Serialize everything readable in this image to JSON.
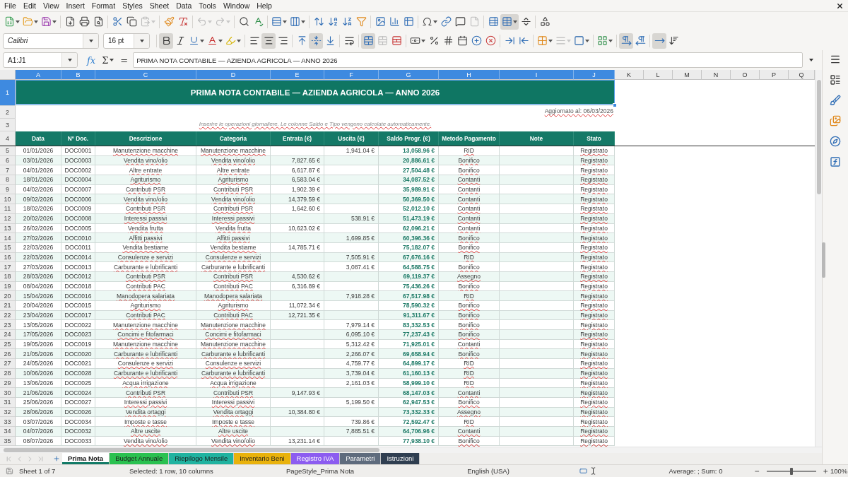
{
  "menu_bar": {
    "items": [
      "File",
      "Edit",
      "View",
      "Insert",
      "Format",
      "Styles",
      "Sheet",
      "Data",
      "Tools",
      "Window",
      "Help"
    ]
  },
  "standard_toolbar": {
    "buttons": [
      {
        "kind": "new",
        "pressed": false,
        "disabled": false
      },
      {
        "kind": "open",
        "pressed": false,
        "disabled": false
      },
      {
        "kind": "save",
        "pressed": false,
        "disabled": false
      },
      {
        "kind": "pdf",
        "pressed": false,
        "disabled": false
      },
      {
        "kind": "print",
        "pressed": false,
        "disabled": false
      },
      {
        "kind": "preview",
        "pressed": false,
        "disabled": false
      },
      {
        "kind": "cut",
        "pressed": false,
        "disabled": false
      },
      {
        "kind": "copy",
        "pressed": false,
        "disabled": false
      },
      {
        "kind": "paste",
        "pressed": false,
        "disabled": true
      },
      {
        "kind": "clone",
        "pressed": false,
        "disabled": false
      },
      {
        "kind": "clear",
        "pressed": false,
        "disabled": false
      },
      {
        "kind": "undo",
        "pressed": false,
        "disabled": true
      },
      {
        "kind": "redo",
        "pressed": false,
        "disabled": true
      },
      {
        "kind": "find",
        "pressed": false,
        "disabled": false
      },
      {
        "kind": "spelling",
        "pressed": false,
        "disabled": false
      },
      {
        "kind": "rows",
        "pressed": false,
        "disabled": false
      },
      {
        "kind": "columns",
        "pressed": false,
        "disabled": false
      },
      {
        "kind": "sort",
        "pressed": false,
        "disabled": false
      },
      {
        "kind": "ascending",
        "pressed": false,
        "disabled": false
      },
      {
        "kind": "descending",
        "pressed": false,
        "disabled": false
      },
      {
        "kind": "autofilter",
        "pressed": false,
        "disabled": false
      },
      {
        "kind": "image",
        "pressed": false,
        "disabled": false
      },
      {
        "kind": "chart",
        "pressed": false,
        "disabled": false
      },
      {
        "kind": "pivot",
        "pressed": false,
        "disabled": false
      },
      {
        "kind": "symbol",
        "pressed": false,
        "disabled": false
      },
      {
        "kind": "hyperlink",
        "pressed": false,
        "disabled": false
      },
      {
        "kind": "comment",
        "pressed": false,
        "disabled": false
      },
      {
        "kind": "headers",
        "pressed": false,
        "disabled": true
      },
      {
        "kind": "printarea",
        "pressed": false,
        "disabled": false
      },
      {
        "kind": "freeze",
        "pressed": true,
        "disabled": false
      },
      {
        "kind": "split",
        "pressed": false,
        "disabled": false
      },
      {
        "kind": "shapes",
        "pressed": false,
        "disabled": false
      }
    ]
  },
  "formatting_toolbar": {
    "font_name": "Calibri",
    "font_size": "16 pt",
    "buttons": [
      {
        "kind": "bold",
        "pressed": true,
        "disabled": false
      },
      {
        "kind": "italic",
        "pressed": false,
        "disabled": false
      },
      {
        "kind": "underline",
        "pressed": false,
        "disabled": false
      },
      {
        "kind": "fontcolor",
        "pressed": false,
        "disabled": false
      },
      {
        "kind": "highlight",
        "pressed": false,
        "disabled": false
      },
      {
        "kind": "left",
        "pressed": false,
        "disabled": false
      },
      {
        "kind": "center",
        "pressed": true,
        "disabled": false
      },
      {
        "kind": "right",
        "pressed": false,
        "disabled": false
      },
      {
        "kind": "top",
        "pressed": false,
        "disabled": false
      },
      {
        "kind": "middle",
        "pressed": true,
        "disabled": false
      },
      {
        "kind": "bottom",
        "pressed": false,
        "disabled": false
      },
      {
        "kind": "wrap",
        "pressed": false,
        "disabled": false
      },
      {
        "kind": "mergecenter",
        "pressed": true,
        "disabled": false
      },
      {
        "kind": "merge",
        "pressed": false,
        "disabled": true
      },
      {
        "kind": "unmerge",
        "pressed": false,
        "disabled": false
      },
      {
        "kind": "currency",
        "pressed": false,
        "disabled": false
      },
      {
        "kind": "percent",
        "pressed": false,
        "disabled": false
      },
      {
        "kind": "number",
        "pressed": false,
        "disabled": false
      },
      {
        "kind": "date",
        "pressed": false,
        "disabled": false
      },
      {
        "kind": "adddecimal",
        "pressed": false,
        "disabled": false
      },
      {
        "kind": "deletedecimal",
        "pressed": false,
        "disabled": false
      },
      {
        "kind": "indent",
        "pressed": false,
        "disabled": false
      },
      {
        "kind": "outdent",
        "pressed": false,
        "disabled": false
      },
      {
        "kind": "borders",
        "pressed": false,
        "disabled": false
      },
      {
        "kind": "borderstyle",
        "pressed": false,
        "disabled": true
      },
      {
        "kind": "bordercolor",
        "pressed": false,
        "disabled": false
      },
      {
        "kind": "conditional",
        "pressed": false,
        "disabled": false
      },
      {
        "kind": "ltr",
        "pressed": true,
        "disabled": false
      },
      {
        "kind": "rtl",
        "pressed": false,
        "disabled": false
      },
      {
        "kind": "direction",
        "pressed": true,
        "disabled": false
      },
      {
        "kind": "stacked",
        "pressed": false,
        "disabled": false
      }
    ]
  },
  "formula_bar": {
    "name_box": "A1:J1",
    "function_symbol": "fx",
    "sum_symbol": "Σ",
    "equals_symbol": "=",
    "content": "PRIMA NOTA CONTABILE — AZIENDA AGRICOLA — ANNO 2026"
  },
  "sheet": {
    "column_headers": [
      {
        "label": "A",
        "selected": true
      },
      {
        "label": "B",
        "selected": true
      },
      {
        "label": "C",
        "selected": true
      },
      {
        "label": "D",
        "selected": true
      },
      {
        "label": "E",
        "selected": true
      },
      {
        "label": "F",
        "selected": true
      },
      {
        "label": "G",
        "selected": true
      },
      {
        "label": "H",
        "selected": true
      },
      {
        "label": "I",
        "selected": true
      },
      {
        "label": "J",
        "selected": true
      },
      {
        "label": "K",
        "selected": false
      },
      {
        "label": "L",
        "selected": false
      },
      {
        "label": "M",
        "selected": false
      },
      {
        "label": "N",
        "selected": false
      },
      {
        "label": "O",
        "selected": false
      },
      {
        "label": "P",
        "selected": false
      },
      {
        "label": "Q",
        "selected": false
      }
    ],
    "row_headers": [
      {
        "label": "1",
        "selected": true
      },
      {
        "label": "2",
        "selected": false
      },
      {
        "label": "3",
        "selected": false
      },
      {
        "label": "4",
        "selected": false
      },
      {
        "label": "5",
        "selected": false
      },
      {
        "label": "6",
        "selected": false
      },
      {
        "label": "7",
        "selected": false
      },
      {
        "label": "8",
        "selected": false
      },
      {
        "label": "9",
        "selected": false
      },
      {
        "label": "10",
        "selected": false
      },
      {
        "label": "11",
        "selected": false
      },
      {
        "label": "12",
        "selected": false
      },
      {
        "label": "13",
        "selected": false
      },
      {
        "label": "14",
        "selected": false
      },
      {
        "label": "15",
        "selected": false
      },
      {
        "label": "16",
        "selected": false
      },
      {
        "label": "17",
        "selected": false
      },
      {
        "label": "18",
        "selected": false
      },
      {
        "label": "19",
        "selected": false
      },
      {
        "label": "20",
        "selected": false
      },
      {
        "label": "21",
        "selected": false
      },
      {
        "label": "22",
        "selected": false
      },
      {
        "label": "23",
        "selected": false
      },
      {
        "label": "24",
        "selected": false
      },
      {
        "label": "25",
        "selected": false
      },
      {
        "label": "26",
        "selected": false
      },
      {
        "label": "27",
        "selected": false
      },
      {
        "label": "28",
        "selected": false
      },
      {
        "label": "29",
        "selected": false
      },
      {
        "label": "30",
        "selected": false
      },
      {
        "label": "31",
        "selected": false
      },
      {
        "label": "32",
        "selected": false
      },
      {
        "label": "33",
        "selected": false
      },
      {
        "label": "34",
        "selected": false
      },
      {
        "label": "35",
        "selected": false
      }
    ],
    "title": "PRIMA NOTA CONTABILE — AZIENDA AGRICOLA — ANNO 2026",
    "updated": {
      "text": "Aggiornato al: 06/03/2026",
      "spelling_flagged": true
    },
    "instructions": {
      "text": "Inserire le operazioni giornaliere. Le colonne Saldo e Tipo vengono calcolate automaticamente.",
      "spelling_flagged": true
    },
    "table": {
      "columns": [
        {
          "label": "Data",
          "spelling_flagged": false
        },
        {
          "label": "Nº Doc.",
          "spelling_flagged": false
        },
        {
          "label": "Descrizione",
          "spelling_flagged": true
        },
        {
          "label": "Categoria",
          "spelling_flagged": true
        },
        {
          "label": "Entrata (€)",
          "spelling_flagged": false
        },
        {
          "label": "Uscita (€)",
          "spelling_flagged": false
        },
        {
          "label": "Saldo Progr. (€)",
          "spelling_flagged": false
        },
        {
          "label": "Metodo Pagamento",
          "spelling_flagged": true
        },
        {
          "label": "Note"
        },
        {
          "label": "Stato",
          "spelling_flagged": true
        }
      ],
      "rows": [
        [
          "01/01/2026",
          "DOC0001",
          "Manutenzione macchine",
          "Manutenzione macchine",
          null,
          "1,941.04 €",
          "13,058.96 €",
          "RID",
          null,
          "Registrato"
        ],
        [
          "03/01/2026",
          "DOC0003",
          "Vendita vino/olio",
          "Vendita vino/olio",
          "7,827.65 €",
          null,
          "20,886.61 €",
          "Bonifico",
          null,
          "Registrato"
        ],
        [
          "04/01/2026",
          "DOC0002",
          "Altre entrate",
          "Altre entrate",
          "6,617.87 €",
          null,
          "27,504.48 €",
          "Bonifico",
          null,
          "Registrato"
        ],
        [
          "18/01/2026",
          "DOC0004",
          "Agriturismo",
          "Agriturismo",
          "6,583.04 €",
          null,
          "34,087.52 €",
          "Contanti",
          null,
          "Registrato"
        ],
        [
          "04/02/2026",
          "DOC0007",
          "Contributi PSR",
          "Contributi PSR",
          "1,902.39 €",
          null,
          "35,989.91 €",
          "Contanti",
          null,
          "Registrato"
        ],
        [
          "09/02/2026",
          "DOC0006",
          "Vendita vino/olio",
          "Vendita vino/olio",
          "14,379.59 €",
          null,
          "50,369.50 €",
          "Contanti",
          null,
          "Registrato"
        ],
        [
          "18/02/2026",
          "DOC0009",
          "Contributi PSR",
          "Contributi PSR",
          "1,642.60 €",
          null,
          "52,012.10 €",
          "Contanti",
          null,
          "Registrato"
        ],
        [
          "20/02/2026",
          "DOC0008",
          "Interessi passivi",
          "Interessi passivi",
          null,
          "538.91 €",
          "51,473.19 €",
          "Contanti",
          null,
          "Registrato"
        ],
        [
          "26/02/2026",
          "DOC0005",
          "Vendita frutta",
          "Vendita frutta",
          "10,623.02 €",
          null,
          "62,096.21 €",
          "Contanti",
          null,
          "Registrato"
        ],
        [
          "27/02/2026",
          "DOC0010",
          "Affitti passivi",
          "Affitti passivi",
          null,
          "1,699.85 €",
          "60,396.36 €",
          "Bonifico",
          null,
          "Registrato"
        ],
        [
          "22/03/2026",
          "DOC0011",
          "Vendita bestiame",
          "Vendita bestiame",
          "14,785.71 €",
          null,
          "75,182.07 €",
          "Bonifico",
          null,
          "Registrato"
        ],
        [
          "22/03/2026",
          "DOC0014",
          "Consulenze e servizi",
          "Consulenze e servizi",
          null,
          "7,505.91 €",
          "67,676.16 €",
          "RID",
          null,
          "Registrato"
        ],
        [
          "27/03/2026",
          "DOC0013",
          "Carburante e lubrificanti",
          "Carburante e lubrificanti",
          null,
          "3,087.41 €",
          "64,588.75 €",
          "Bonifico",
          null,
          "Registrato"
        ],
        [
          "28/03/2026",
          "DOC0012",
          "Contributi PSR",
          "Contributi PSR",
          "4,530.62 €",
          null,
          "69,119.37 €",
          "Assegno",
          null,
          "Registrato"
        ],
        [
          "08/04/2026",
          "DOC0018",
          "Contributi PAC",
          "Contributi PAC",
          "6,316.89 €",
          null,
          "75,436.26 €",
          "Bonifico",
          null,
          "Registrato"
        ],
        [
          "15/04/2026",
          "DOC0016",
          "Manodopera salariata",
          "Manodopera salariata",
          null,
          "7,918.28 €",
          "67,517.98 €",
          "RID",
          null,
          "Registrato"
        ],
        [
          "20/04/2026",
          "DOC0015",
          "Agriturismo",
          "Agriturismo",
          "11,072.34 €",
          null,
          "78,590.32 €",
          "Bonifico",
          null,
          "Registrato"
        ],
        [
          "23/04/2026",
          "DOC0017",
          "Contributi PAC",
          "Contributi PAC",
          "12,721.35 €",
          null,
          "91,311.67 €",
          "Bonifico",
          null,
          "Registrato"
        ],
        [
          "13/05/2026",
          "DOC0022",
          "Manutenzione macchine",
          "Manutenzione macchine",
          null,
          "7,979.14 €",
          "83,332.53 €",
          "Bonifico",
          null,
          "Registrato"
        ],
        [
          "17/05/2026",
          "DOC0023",
          "Concimi e fitofarmaci",
          "Concimi e fitofarmaci",
          null,
          "6,095.10 €",
          "77,237.43 €",
          "Bonifico",
          null,
          "Registrato"
        ],
        [
          "19/05/2026",
          "DOC0019",
          "Manutenzione macchine",
          "Manutenzione macchine",
          null,
          "5,312.42 €",
          "71,925.01 €",
          "Contanti",
          null,
          "Registrato"
        ],
        [
          "21/05/2026",
          "DOC0020",
          "Carburante e lubrificanti",
          "Carburante e lubrificanti",
          null,
          "2,266.07 €",
          "69,658.94 €",
          "Bonifico",
          null,
          "Registrato"
        ],
        [
          "24/05/2026",
          "DOC0021",
          "Consulenze e servizi",
          "Consulenze e servizi",
          null,
          "4,759.77 €",
          "64,899.17 €",
          "RID",
          null,
          "Registrato"
        ],
        [
          "10/06/2026",
          "DOC0028",
          "Carburante e lubrificanti",
          "Carburante e lubrificanti",
          null,
          "3,739.04 €",
          "61,160.13 €",
          "RID",
          null,
          "Registrato"
        ],
        [
          "13/06/2026",
          "DOC0025",
          "Acqua irrigazione",
          "Acqua irrigazione",
          null,
          "2,161.03 €",
          "58,999.10 €",
          "RID",
          null,
          "Registrato"
        ],
        [
          "21/06/2026",
          "DOC0024",
          "Contributi PSR",
          "Contributi PSR",
          "9,147.93 €",
          null,
          "68,147.03 €",
          "Contanti",
          null,
          "Registrato"
        ],
        [
          "25/06/2026",
          "DOC0027",
          "Interessi passivi",
          "Interessi passivi",
          null,
          "5,199.50 €",
          "62,947.53 €",
          "Bonifico",
          null,
          "Registrato"
        ],
        [
          "28/06/2026",
          "DOC0026",
          "Vendita ortaggi",
          "Vendita ortaggi",
          "10,384.80 €",
          null,
          "73,332.33 €",
          "Assegno",
          null,
          "Registrato"
        ],
        [
          "03/07/2026",
          "DOC0034",
          "Imposte e tasse",
          "Imposte e tasse",
          null,
          "739.86 €",
          "72,592.47 €",
          "RID",
          null,
          "Registrato"
        ],
        [
          "04/07/2026",
          "DOC0032",
          "Altre uscite",
          "Altre uscite",
          null,
          "7,885.51 €",
          "64,706.96 €",
          "Contanti",
          null,
          "Registrato"
        ],
        [
          "08/07/2026",
          "DOC0033",
          "Vendita vino/olio",
          "Vendita vino/olio",
          "13,231.14 €",
          null,
          "77,938.10 €",
          "Bonifico",
          null,
          "Registrato"
        ]
      ]
    }
  },
  "sheet_tabs": [
    {
      "label": "Prima Nota",
      "selected": true,
      "color": "#127a66"
    },
    {
      "label": "Budget Annuale",
      "selected": false,
      "color": "#2ac150"
    },
    {
      "label": "Riepilogo Mensile",
      "selected": false,
      "color": "#20b3a0"
    },
    {
      "label": "Inventario Beni",
      "selected": false,
      "color": "#e9b20c"
    },
    {
      "label": "Registro IVA",
      "selected": false,
      "color": "#8c5cf0"
    },
    {
      "label": "Parametri",
      "selected": false,
      "color": "#5e6b7d"
    },
    {
      "label": "Istruzioni",
      "selected": false,
      "color": "#2f3e50"
    }
  ],
  "status_bar": {
    "sheet": "Sheet 1 of 7",
    "selection": "Selected: 1 row, 10 columns",
    "page_style": "PageStyle_Prima Nota",
    "language": "English (USA)",
    "summary": "Average: ; Sum: 0",
    "zoom_slider": {
      "level": 0.5
    },
    "zoom": "100%"
  }
}
